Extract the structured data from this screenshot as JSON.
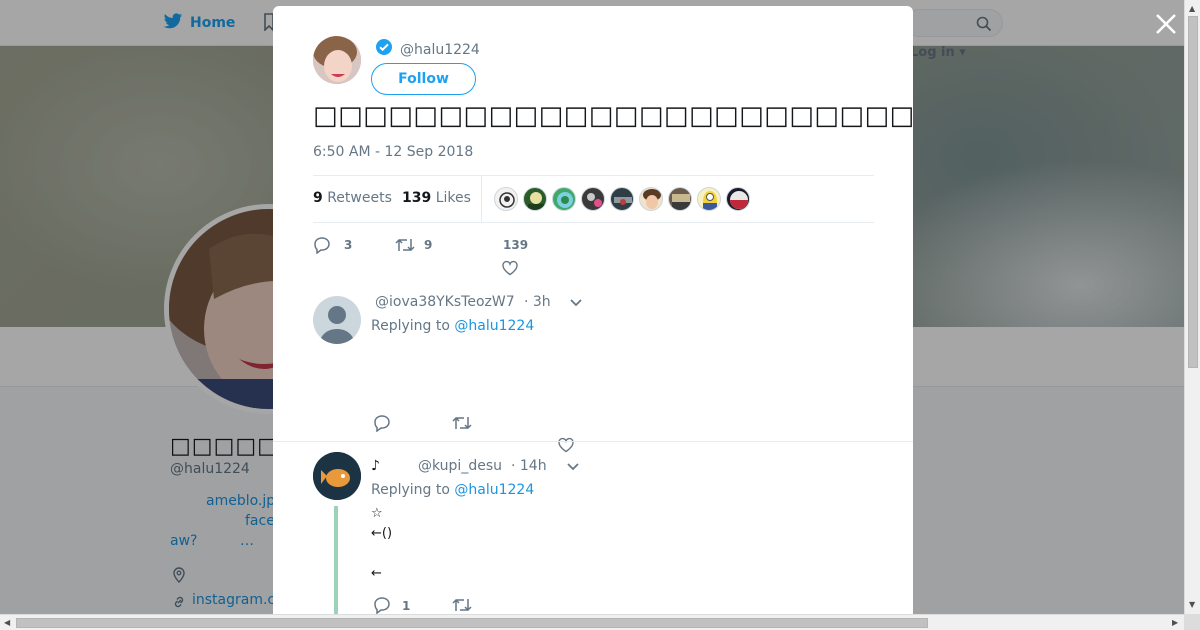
{
  "colors": {
    "accent": "#1da1f2",
    "link": "#1b95e0",
    "muted": "#657786",
    "thread": "#9ed2b6"
  },
  "nav": {
    "home_label": "Home",
    "login_label": "Log in ▾",
    "search_icon": "search-icon"
  },
  "profile": {
    "name": "□□□□□",
    "handle": "@halu1224",
    "bio_line1": "ameblo.jp",
    "bio_line2": "face",
    "bio_line3a": "aw?",
    "bio_line3b": "…",
    "link": "instagram.c"
  },
  "tweet": {
    "handle": "@halu1224",
    "follow_label": "Follow",
    "text": "□□□□□□□□□□□□□□□□□□□□□□□□□□□? □□□□□□□□□□□□□□□□□□□□□□□□□□□□□□□□□□□□□□□□□□",
    "time": "6:50 AM - 12 Sep 2018",
    "retweets_count": "9",
    "retweets_label": "Retweets",
    "likes_count": "139",
    "likes_label": "Likes",
    "reply_count": "3",
    "retweet_count": "9",
    "like_count": "139"
  },
  "replies": [
    {
      "handle": "@iova38YKsTeozW7",
      "time": "· 3h",
      "replying_prefix": "Replying to",
      "replying_to": "@halu1224",
      "lines": []
    },
    {
      "name_prefix": "♪",
      "handle": "@kupi_desu",
      "time": "· 14h",
      "replying_prefix": "Replying to",
      "replying_to": "@halu1224",
      "lines": [
        "☆",
        "←()",
        "",
        "←"
      ],
      "reply_count": "1"
    }
  ]
}
